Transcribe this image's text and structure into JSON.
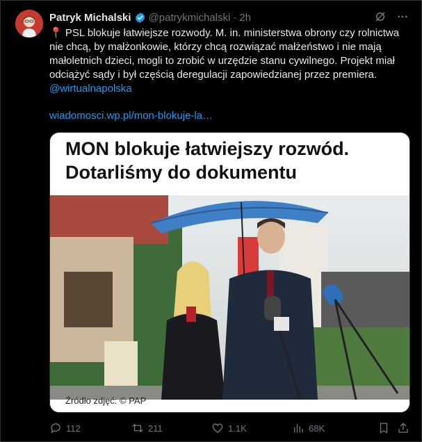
{
  "tweet": {
    "author_name": "Patryk Michalski",
    "handle": "@patrykmichalski",
    "separator": "·",
    "time": "2h",
    "body_pin": "📍",
    "body_text": " PSL blokuje łatwiejsze rozwody. M. in. ministerstwa obrony czy rolnictwa nie chcą, by małżonkowie, którzy chcą rozwiązać małżeństwo i nie mają małoletnich dzieci, mogli to zrobić w urzędzie stanu cywilnego. Projekt miał odciążyć sądy i był częścią deregulacji zapowiedzianej przez premiera. ",
    "mention": "@wirtualnapolska",
    "link": "wiadomosci.wp.pl/mon-blokuje-la…"
  },
  "card": {
    "headline": "MON blokuje łatwiejszy rozwód. Dotarliśmy do dokumentu",
    "caption": "Źródło zdjęć: © PAP"
  },
  "actions": {
    "replies": "112",
    "retweets": "211",
    "likes": "1.1K",
    "views": "68K"
  },
  "colors": {
    "accent": "#1d9bf0",
    "muted": "#71767b",
    "text": "#e7e9ea",
    "background": "#000000"
  },
  "icons": [
    "verified-badge-icon",
    "grok-icon",
    "more-icon",
    "reply-icon",
    "retweet-icon",
    "like-icon",
    "views-icon",
    "bookmark-icon",
    "share-icon"
  ]
}
